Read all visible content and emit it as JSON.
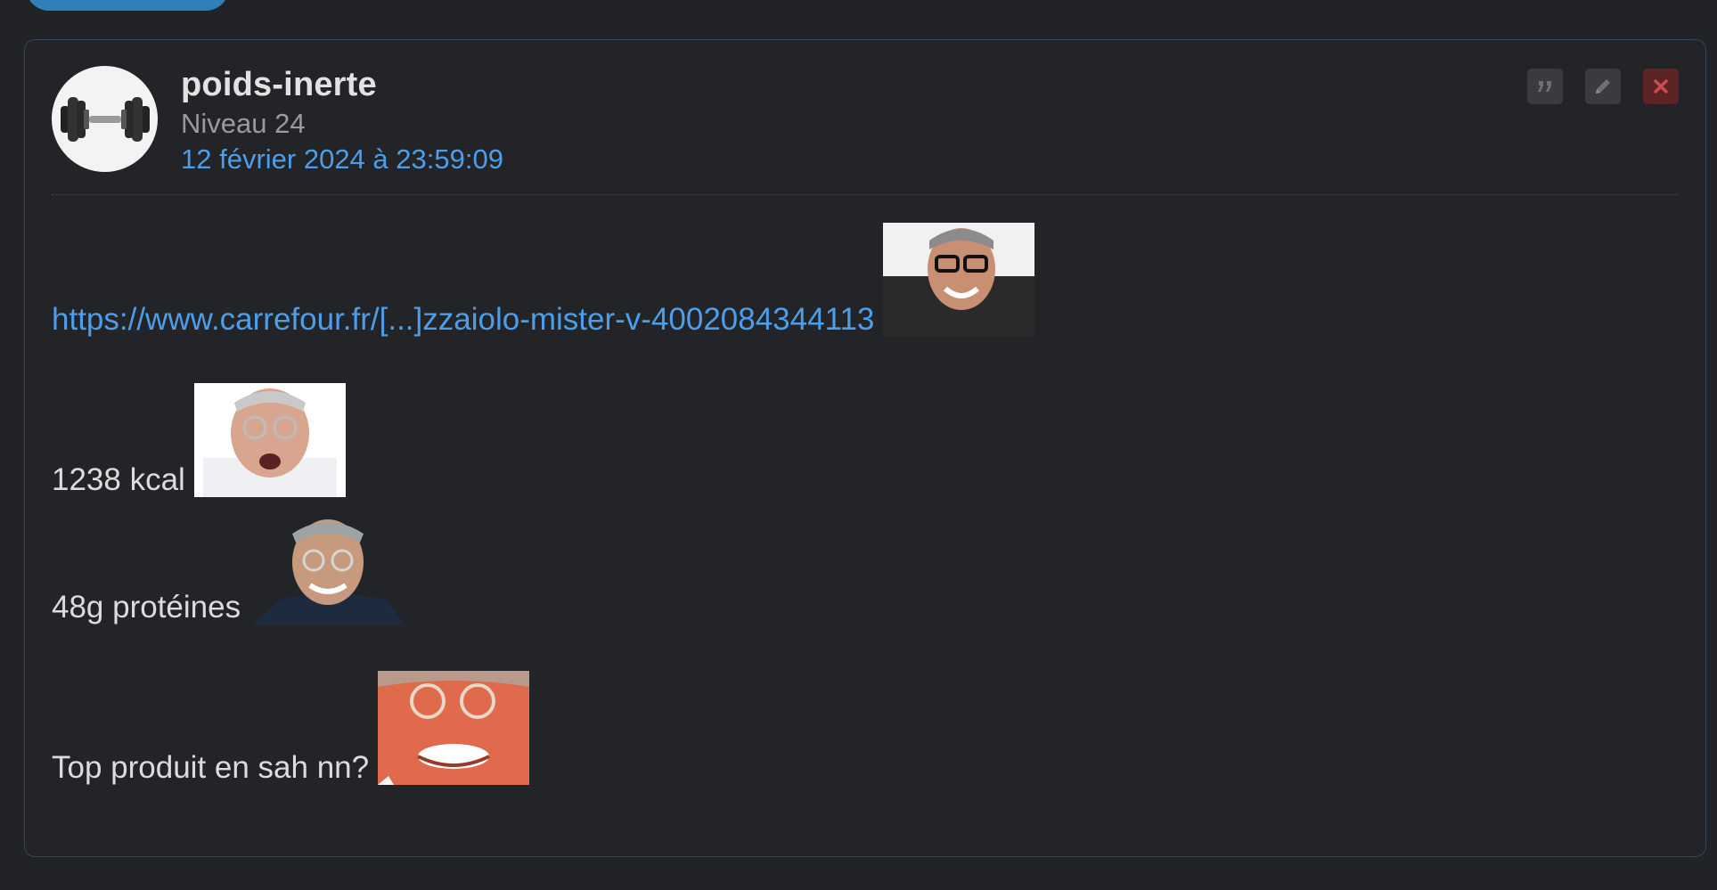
{
  "post": {
    "author": "poids-inerte",
    "level": "Niveau 24",
    "date": "12 février 2024 à 23:59:09",
    "actions": [
      {
        "name": "quote",
        "icon": "quote-icon"
      },
      {
        "name": "edit",
        "icon": "pencil-icon"
      },
      {
        "name": "delete",
        "icon": "close-icon"
      }
    ],
    "body": {
      "link": "https://www.carrefour.fr/[...]zzaiolo-mister-v-4002084344113",
      "kcal": "1238 kcal",
      "proteins": "48g protéines",
      "question": "Top produit en sah nn?"
    }
  },
  "colors": {
    "background": "#222326",
    "card_border": "#34445a",
    "link": "#4d9eea",
    "delete": "#5d2426"
  }
}
